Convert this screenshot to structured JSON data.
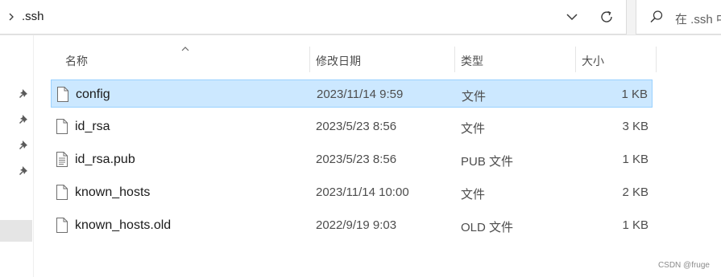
{
  "address": {
    "path": ".ssh"
  },
  "search": {
    "placeholder": "在 .ssh 中"
  },
  "columns": {
    "name": "名称",
    "date": "修改日期",
    "type": "类型",
    "size": "大小"
  },
  "files": [
    {
      "name": "config",
      "date": "2023/11/14 9:59",
      "type": "文件",
      "size": "1 KB",
      "icon": "file-icon",
      "selected": true
    },
    {
      "name": "id_rsa",
      "date": "2023/5/23 8:56",
      "type": "文件",
      "size": "3 KB",
      "icon": "file-icon",
      "selected": false
    },
    {
      "name": "id_rsa.pub",
      "date": "2023/5/23 8:56",
      "type": "PUB 文件",
      "size": "1 KB",
      "icon": "text-file-icon",
      "selected": false
    },
    {
      "name": "known_hosts",
      "date": "2023/11/14 10:00",
      "type": "文件",
      "size": "2 KB",
      "icon": "file-icon",
      "selected": false
    },
    {
      "name": "known_hosts.old",
      "date": "2022/9/19 9:03",
      "type": "OLD 文件",
      "size": "1 KB",
      "icon": "file-icon",
      "selected": false
    }
  ],
  "watermark": "CSDN @fruge",
  "colors": {
    "selection_bg": "#cce8ff",
    "selection_border": "#99d1ff"
  }
}
